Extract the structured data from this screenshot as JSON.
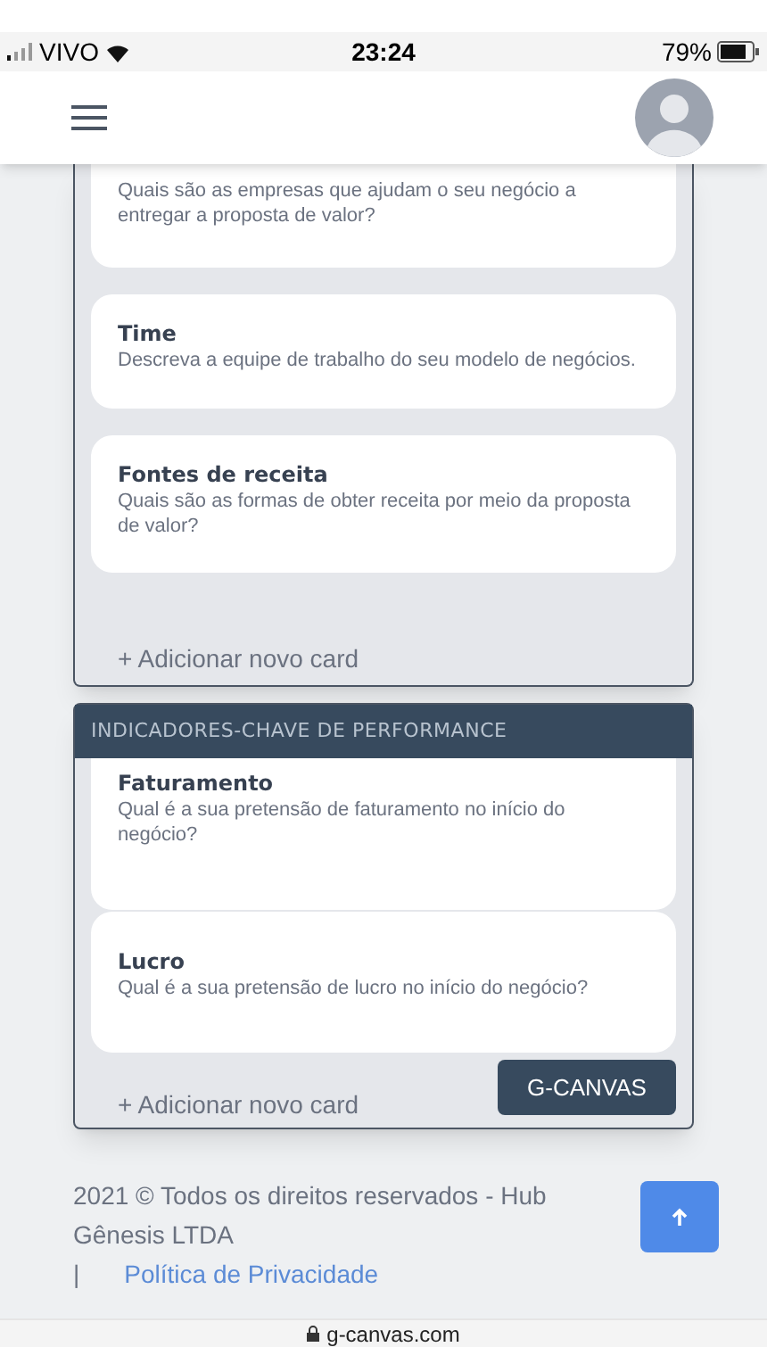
{
  "status_bar": {
    "carrier": "VIVO",
    "time": "23:24",
    "battery": "79%"
  },
  "panels": [
    {
      "cards": [
        {
          "description": "Quais são as empresas que ajudam o seu negócio a entregar a proposta de valor?"
        },
        {
          "title": "Time",
          "description": "Descreva a equipe de trabalho do seu modelo de negócios."
        },
        {
          "title": "Fontes de receita",
          "description": "Quais são as formas de obter receita por meio da proposta de valor?"
        }
      ],
      "add_label": "+ Adicionar novo card"
    },
    {
      "title": "INDICADORES-CHAVE DE PERFORMANCE",
      "cards": [
        {
          "title": "Faturamento",
          "description": "Qual é a sua pretensão de faturamento no início do negócio?"
        },
        {
          "title": "Lucro",
          "description": "Qual é a sua pretensão de lucro no início do negócio?"
        }
      ],
      "add_label": "+ Adicionar novo card",
      "button": "G-CANVAS"
    }
  ],
  "footer": {
    "copyright": "2021 © Todos os direitos reservados - Hub Gênesis LTDA",
    "separator": "|",
    "link": "Política de Privacidade"
  },
  "url_bar": {
    "domain": "g-canvas.com"
  }
}
